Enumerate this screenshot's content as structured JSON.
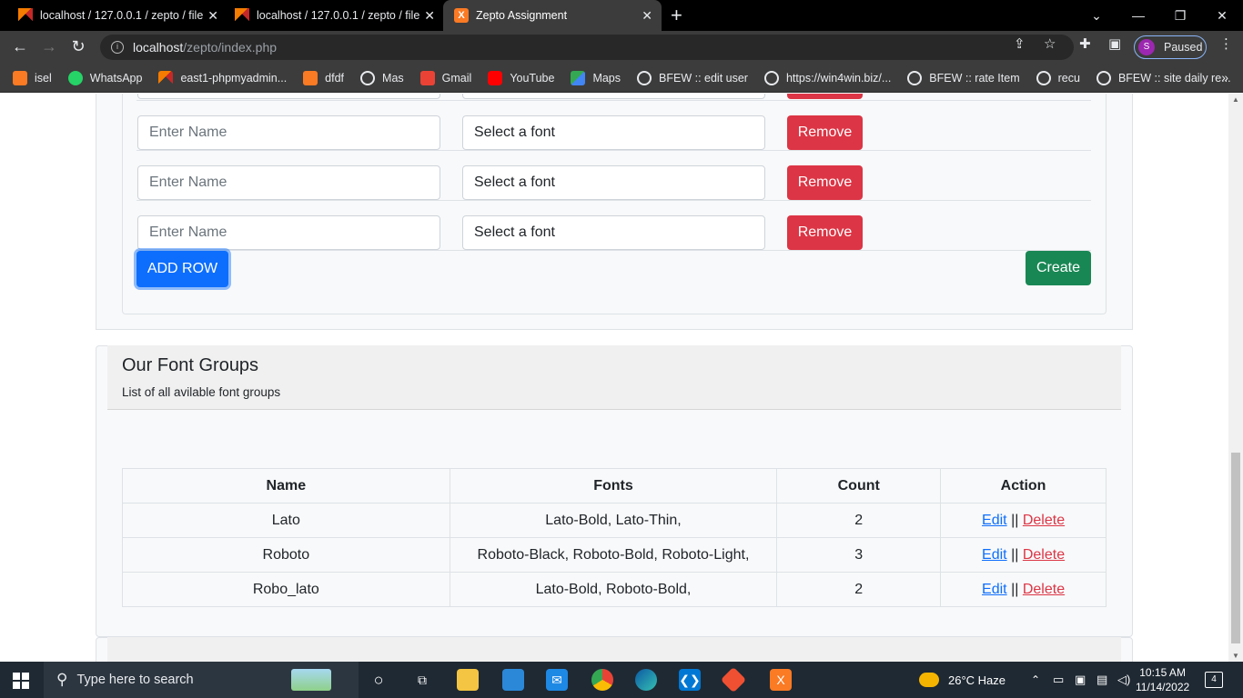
{
  "browser": {
    "tabs": [
      {
        "title": "localhost / 127.0.0.1 / zepto / file",
        "icon": "phpmyadmin-icon"
      },
      {
        "title": "localhost / 127.0.0.1 / zepto / file",
        "icon": "phpmyadmin-icon"
      },
      {
        "title": "Zepto Assignment",
        "icon": "xampp-icon",
        "active": true
      }
    ],
    "url_host": "localhost",
    "url_path": "/zepto/index.php",
    "profile_initial": "S",
    "profile_label": "Paused",
    "bookmarks": [
      {
        "label": "isel",
        "icon": "xampp-icon"
      },
      {
        "label": "WhatsApp",
        "icon": "whatsapp-icon"
      },
      {
        "label": "east1-phpmyadmin...",
        "icon": "phpmyadmin-icon"
      },
      {
        "label": "dfdf",
        "icon": "xampp-icon"
      },
      {
        "label": "Mas",
        "icon": "globe-icon"
      },
      {
        "label": "Gmail",
        "icon": "gmail-icon"
      },
      {
        "label": "YouTube",
        "icon": "youtube-icon"
      },
      {
        "label": "Maps",
        "icon": "maps-icon"
      },
      {
        "label": "BFEW :: edit user",
        "icon": "globe-icon"
      },
      {
        "label": "https://win4win.biz/...",
        "icon": "globe-icon"
      },
      {
        "label": "BFEW :: rate Item",
        "icon": "globe-icon"
      },
      {
        "label": "recu",
        "icon": "globe-icon"
      },
      {
        "label": "BFEW :: site daily re...",
        "icon": "globe-icon"
      }
    ]
  },
  "form": {
    "name_placeholder": "Enter Name",
    "font_select_label": "Select a font",
    "remove_label": "Remove",
    "add_row_label": "ADD ROW",
    "create_label": "Create"
  },
  "groups": {
    "title": "Our Font Groups",
    "subtitle": "List of all avilable font groups",
    "headers": [
      "Name",
      "Fonts",
      "Count",
      "Action"
    ],
    "rows": [
      {
        "name": "Lato",
        "fonts": "Lato-Bold, Lato-Thin,",
        "count": "2"
      },
      {
        "name": "Roboto",
        "fonts": "Roboto-Black, Roboto-Bold, Roboto-Light,",
        "count": "3"
      },
      {
        "name": "Robo_lato",
        "fonts": "Lato-Bold, Roboto-Bold,",
        "count": "2"
      }
    ],
    "edit_label": "Edit",
    "separator": "||",
    "delete_label": "Delete"
  },
  "taskbar": {
    "search_placeholder": "Type here to search",
    "weather": "26°C  Haze",
    "time": "10:15 AM",
    "date": "11/14/2022",
    "notifications": "4"
  }
}
